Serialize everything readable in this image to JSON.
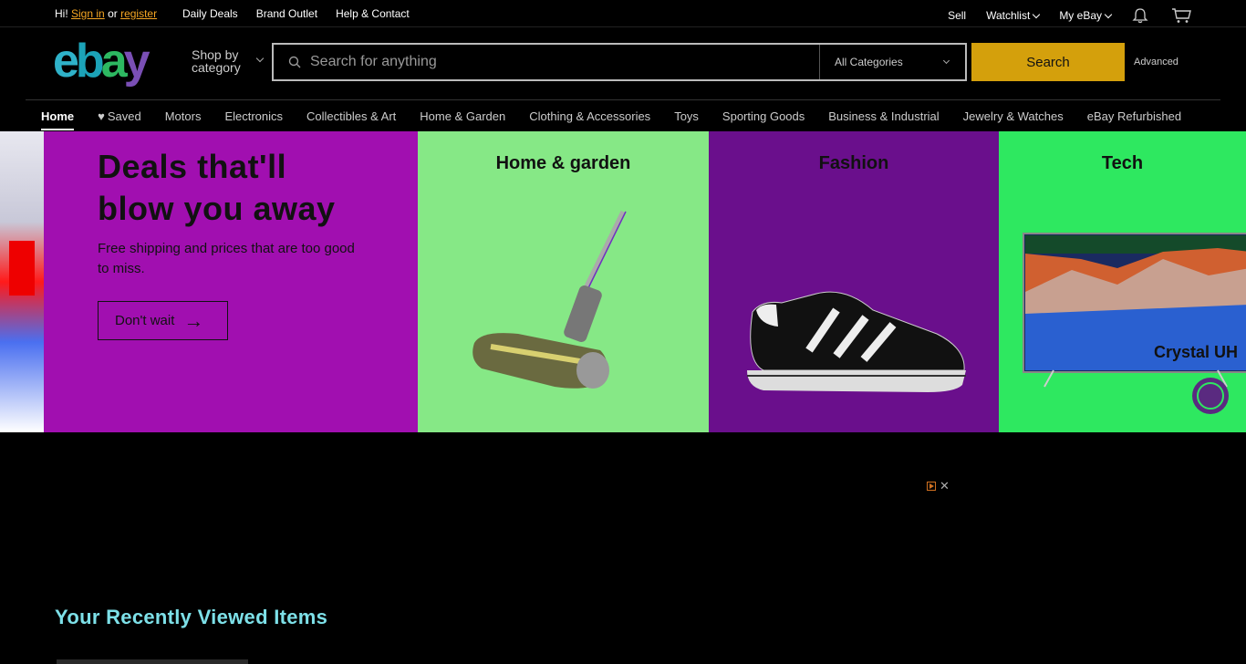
{
  "topbar": {
    "greeting": "Hi!",
    "sign_in": "Sign in",
    "or": "or",
    "register": "register",
    "links": [
      "Daily Deals",
      "Brand Outlet",
      "Help & Contact"
    ],
    "sell": "Sell",
    "watchlist": "Watchlist",
    "my_ebay": "My eBay"
  },
  "header": {
    "logo": [
      "e",
      "b",
      "a",
      "y"
    ],
    "shop_by_category": [
      "Shop by",
      "category"
    ],
    "search_placeholder": "Search for anything",
    "category_select": "All Categories",
    "search_button": "Search",
    "advanced": "Advanced"
  },
  "category_nav": [
    "Home",
    "Saved",
    "Motors",
    "Electronics",
    "Collectibles & Art",
    "Home & Garden",
    "Clothing & Accessories",
    "Toys",
    "Sporting Goods",
    "Business & Industrial",
    "Jewelry & Watches",
    "eBay Refurbished"
  ],
  "hero": {
    "title_line1": "Deals that'll",
    "title_line2": "blow you away",
    "subtitle": "Free shipping and prices that are too good to miss.",
    "cta": "Don't wait",
    "panels": [
      "Home & garden",
      "Fashion",
      "Tech"
    ],
    "tech_tv_text": "Crystal UH"
  },
  "colors": {
    "search_button": "#d4a00c",
    "hero_main": "#a10fb0",
    "home_panel": "#86e886",
    "fashion_panel": "#6a0f8c",
    "tech_panel": "#2ee860"
  },
  "recently_viewed": {
    "title": "Your Recently Viewed Items"
  }
}
